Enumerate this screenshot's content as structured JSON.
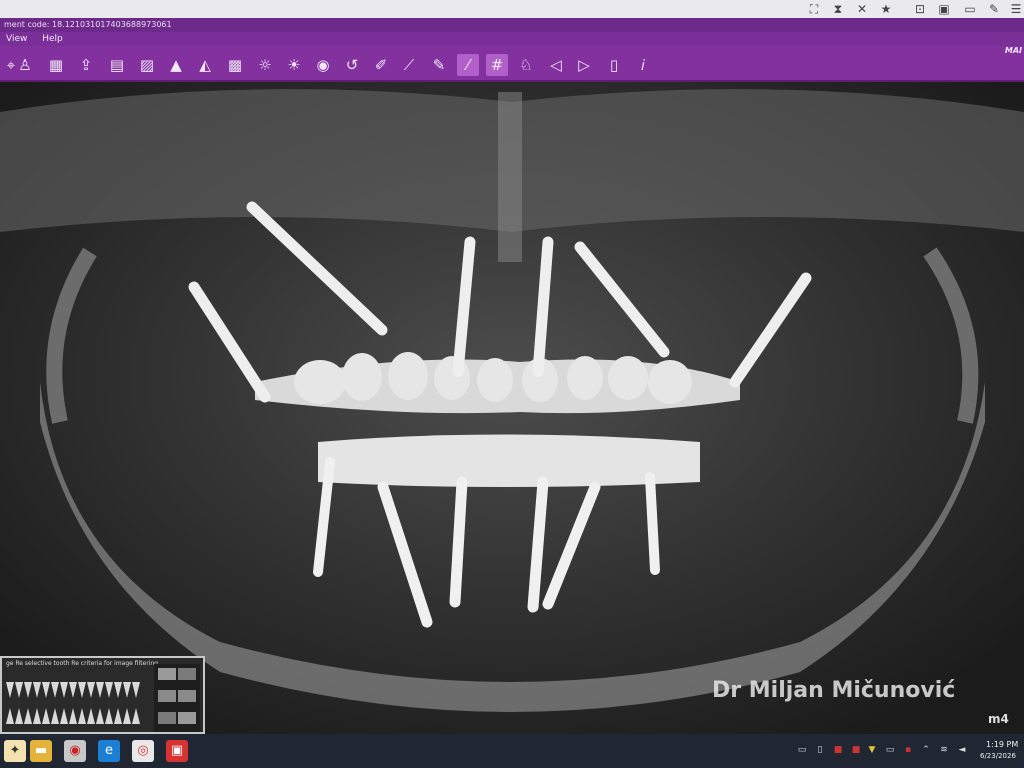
{
  "app": {
    "title": "ment code: 18.121031017403688973061",
    "menu": [
      "View",
      "Help"
    ],
    "mode_label": "MAI"
  },
  "viewer": {
    "watermark": "Dr Miljan Mičunović",
    "logo": "m4"
  },
  "tooth_chart": {
    "caption": "ge Re selective tooth Re criteria for image filtering"
  },
  "clock": {
    "time": "1:19 PM",
    "date": "6/23/2026"
  },
  "colors": {
    "toolbar": "#82319f",
    "title": "#6e2a8a",
    "taskbar": "#202733"
  }
}
